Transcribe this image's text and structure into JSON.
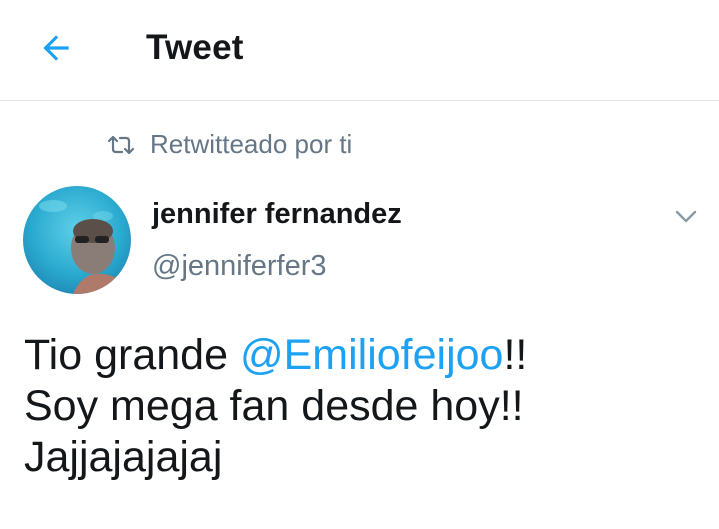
{
  "header": {
    "title": "Tweet",
    "back_icon": "arrow-left-icon",
    "accent_color": "#1da1f2"
  },
  "retweet": {
    "label": "Retwitteado por ti",
    "icon": "retweet-icon"
  },
  "tweet": {
    "author_name": "jennifer fernandez",
    "author_handle": "@jenniferfer3",
    "text_before_mention": "Tio grande ",
    "mention": "@Emiliofeijoo",
    "text_after_mention": "!!",
    "line2": "Soy mega fan desde hoy!!",
    "line3": "Jajjajajajaj",
    "more_icon": "chevron-down-icon"
  }
}
